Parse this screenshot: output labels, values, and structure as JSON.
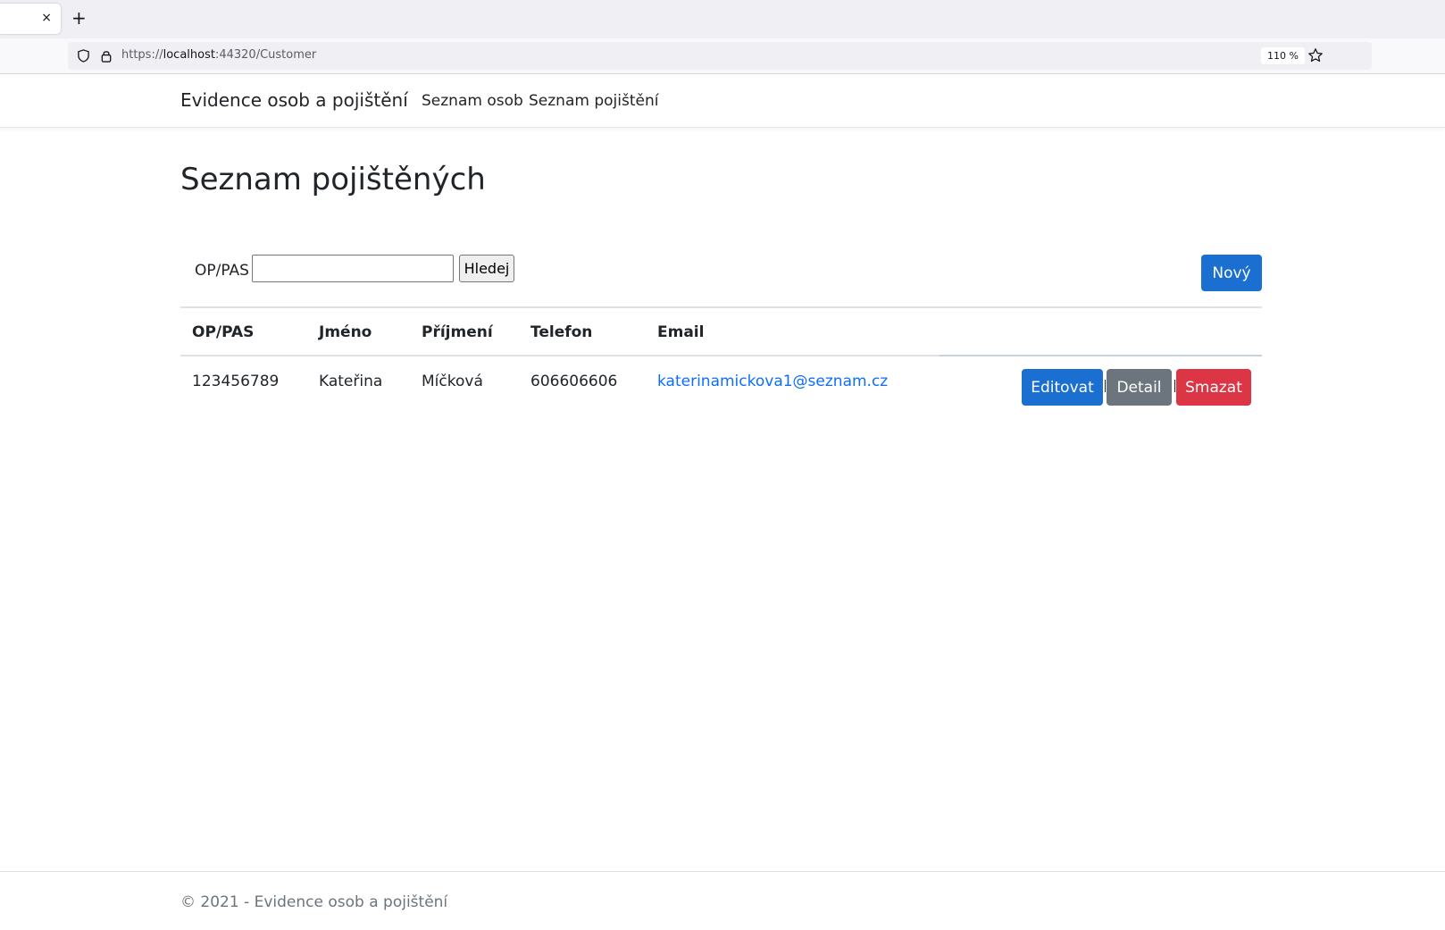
{
  "browser": {
    "tab_close": "×",
    "new_tab": "+",
    "url": {
      "scheme": "https://",
      "host": "localhost",
      "rest": ":44320/Customer"
    },
    "zoom": "110 %"
  },
  "navbar": {
    "brand": "Evidence osob a pojištění",
    "links": [
      "Seznam osob",
      "Seznam pojištění"
    ]
  },
  "page": {
    "title": "Seznam pojištěných",
    "search": {
      "label": "OP/PAS",
      "value": "",
      "placeholder": "",
      "button": "Hledej"
    },
    "new_button": "Nový"
  },
  "table": {
    "headers": [
      "OP/PAS",
      "Jméno",
      "Příjmení",
      "Telefon",
      "Email"
    ],
    "rows": [
      {
        "op_pas": "123456789",
        "jmeno": "Kateřina",
        "prijmeni": "Míčková",
        "telefon": "606606606",
        "email": "katerinamickova1@seznam.cz",
        "actions": {
          "edit": "Editovat",
          "detail": "Detail",
          "delete": "Smazat"
        }
      }
    ]
  },
  "footer": {
    "text": "© 2021 - Evidence osob a pojištění"
  },
  "colors": {
    "primary": "#1a6fd0",
    "secondary": "#6c757d",
    "danger": "#dc3545",
    "link": "#0d6efd"
  },
  "icons": [
    "shield-icon",
    "lock-icon",
    "star-icon",
    "close-icon",
    "plus-icon"
  ]
}
